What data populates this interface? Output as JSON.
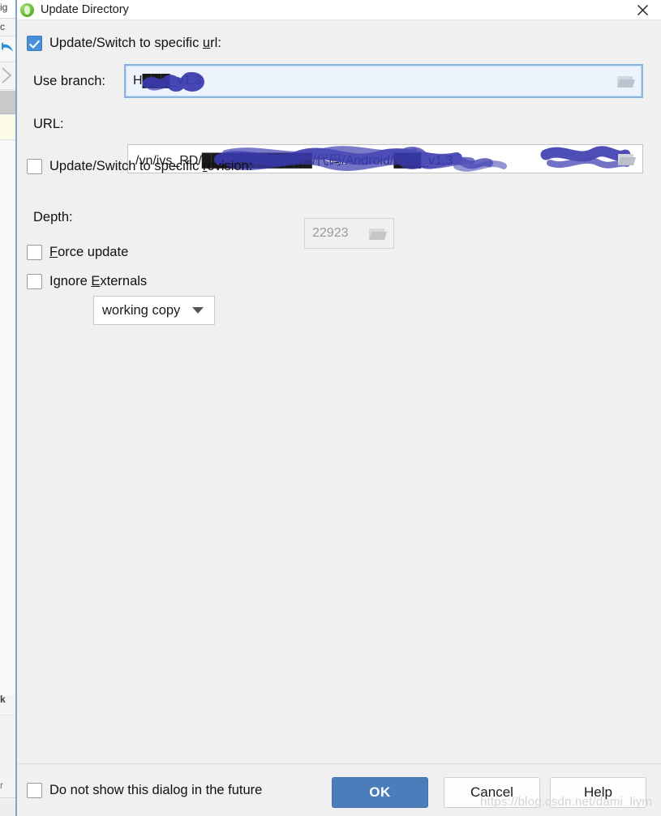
{
  "window": {
    "title": "Update Directory",
    "icon": "tortoisesvn-green-icon",
    "close_label": "✕"
  },
  "form": {
    "specific_url": {
      "label_pre": "Update/Switch to specific ",
      "label_accel": "u",
      "label_post": "rl:",
      "label_full": "Update/Switch to specific url:",
      "checked": true
    },
    "branch": {
      "label": "Use branch:",
      "value": "H███_v1.3",
      "browse_label": "Browse",
      "focused": true
    },
    "url": {
      "label": "URL:",
      "value": "/vn/ivs_RD/████████████/代码/Android/███_v1.3",
      "value_head": "/n/ivs_RD/",
      "value_tail": "/代码/Android/",
      "value_end": "_v1.3",
      "browse_label": "Browse"
    },
    "specific_revision": {
      "label_pre": "Update/Switch to specific ",
      "label_accel": "r",
      "label_post": "evision:",
      "label_full": "Update/Switch to specific revision:",
      "checked": false,
      "revision_value": "22923",
      "enabled": false,
      "browse_label": "Browse"
    },
    "depth": {
      "label": "Depth:",
      "selected": "working copy"
    },
    "force_update": {
      "label_pre": "",
      "label_accel": "F",
      "label_post": "orce update",
      "label_full": "Force update",
      "checked": false
    },
    "ignore_externals": {
      "label_pre": "Ignore ",
      "label_accel": "E",
      "label_post": "xternals",
      "label_full": "Ignore Externals",
      "checked": false
    }
  },
  "footer": {
    "do_not_show": {
      "label": "Do not show this dialog in the future",
      "checked": false
    },
    "ok_label": "OK",
    "cancel_label": "Cancel",
    "help_label": "Help"
  },
  "watermark": "https://blog.csdn.net/dami_liym",
  "colors": {
    "accent": "#4a7dba",
    "checkbox_checked": "#4a90d9",
    "focus_border": "#8ab4de",
    "dialog_bg": "#f0f0f0",
    "redaction": "#3b3bb0"
  },
  "background_window": {
    "fragments": [
      "ig",
      "c",
      "k",
      "r"
    ]
  }
}
